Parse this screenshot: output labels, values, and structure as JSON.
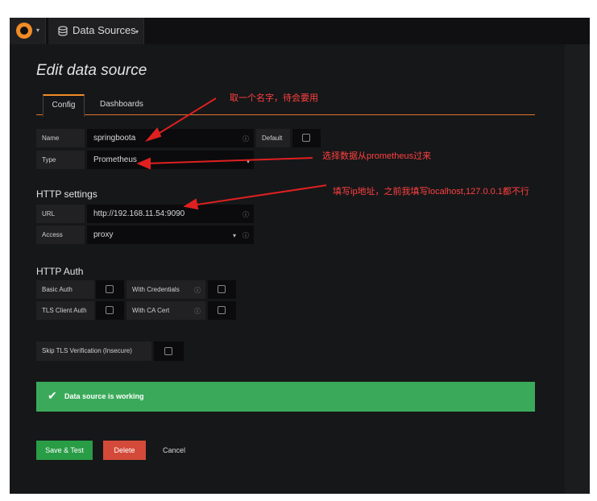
{
  "navbar": {
    "datasources_label": "Data Sources"
  },
  "page": {
    "title": "Edit data source"
  },
  "tabs": [
    {
      "label": "Config"
    },
    {
      "label": "Dashboards"
    }
  ],
  "form": {
    "name_label": "Name",
    "name_value": "springboota",
    "default_label": "Default",
    "type_label": "Type",
    "type_value": "Prometheus"
  },
  "http": {
    "heading": "HTTP settings",
    "url_label": "URL",
    "url_value": "http://192.168.11.54:9090",
    "access_label": "Access",
    "access_value": "proxy"
  },
  "auth": {
    "heading": "HTTP Auth",
    "basic_label": "Basic Auth",
    "with_credentials_label": "With Credentials",
    "tls_label": "TLS Client Auth",
    "ca_cert_label": "With CA Cert",
    "skip_tls_label": "Skip TLS Verification (Insecure)"
  },
  "status": {
    "message": "Data source is working"
  },
  "buttons": {
    "save": "Save & Test",
    "delete": "Delete",
    "cancel": "Cancel"
  },
  "annotations": {
    "name_note": "取一个名字，待会要用",
    "type_note": "选择数据从prometheus过来",
    "url_note": "填写ip地址，之前我填写localhost,127.0.0.1都不行"
  },
  "colors": {
    "accent": "#f08b26",
    "success": "#3aaa5a",
    "save": "#299c46",
    "delete": "#d44a3a",
    "annotation": "#ff4040"
  }
}
